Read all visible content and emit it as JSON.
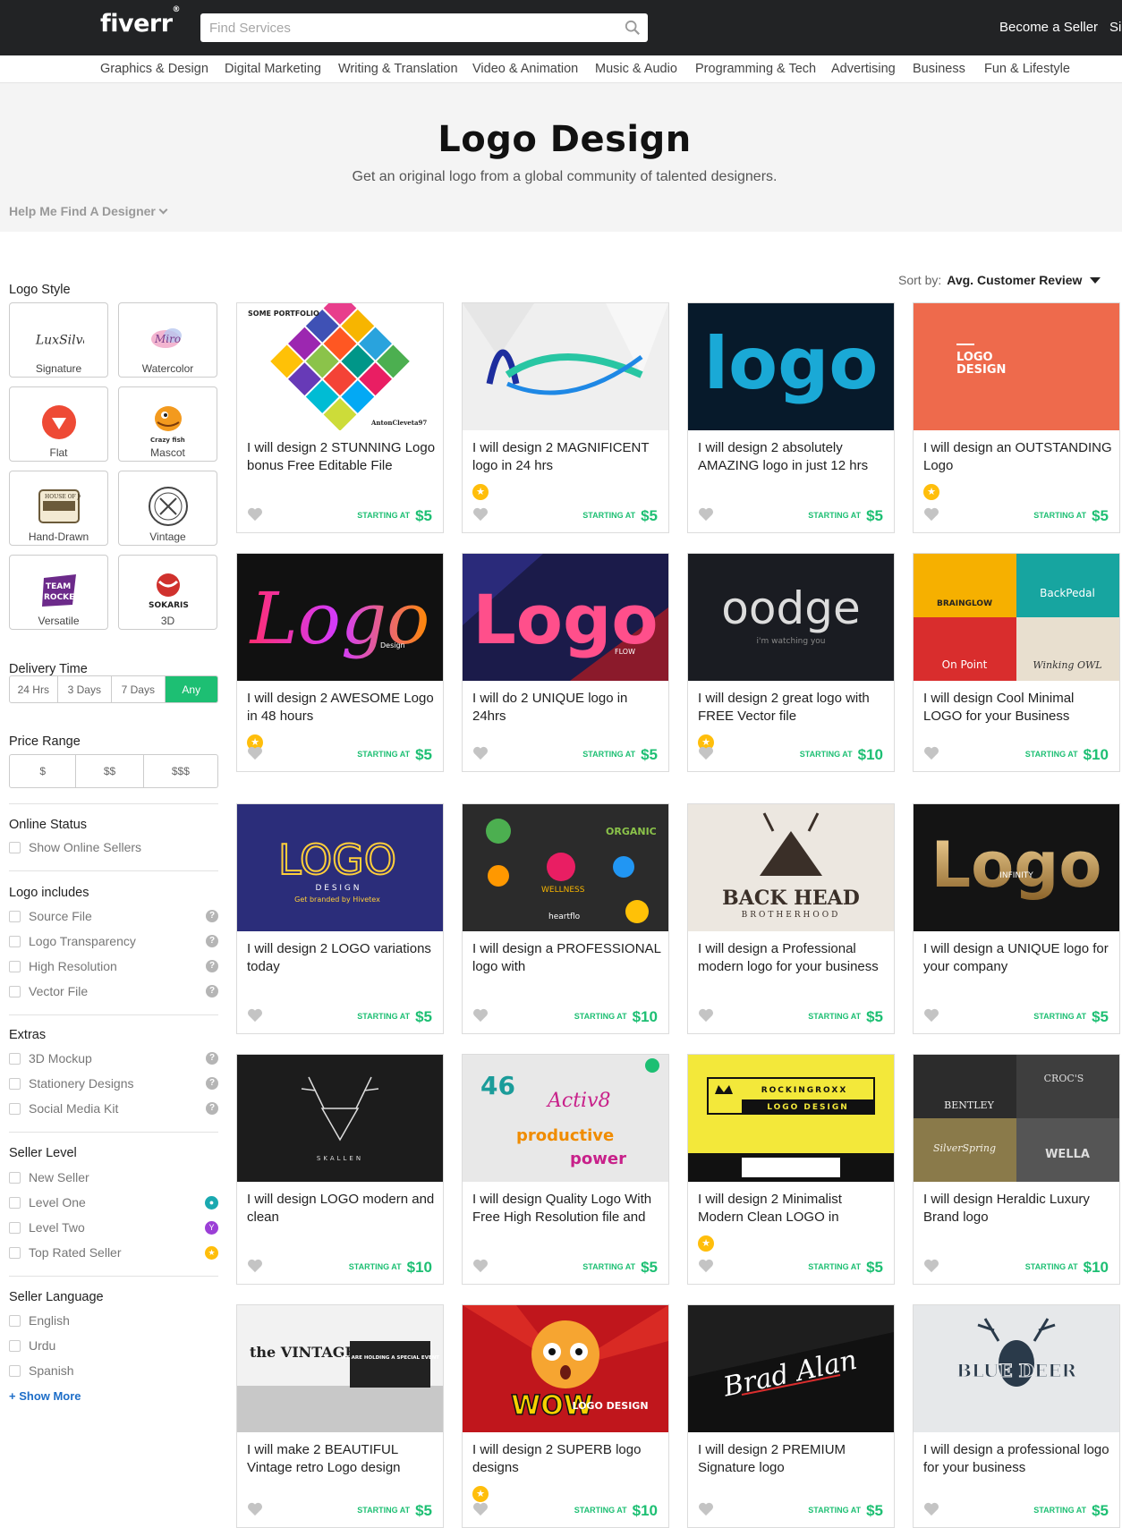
{
  "header": {
    "logo": "fiverr",
    "search_placeholder": "Find Services",
    "become_seller": "Become a Seller",
    "signin": "Sign In"
  },
  "nav": [
    "Graphics & Design",
    "Digital Marketing",
    "Writing & Translation",
    "Video & Animation",
    "Music & Audio",
    "Programming & Tech",
    "Advertising",
    "Business",
    "Fun & Lifestyle"
  ],
  "hero": {
    "title": "Logo Design",
    "subtitle": "Get an original logo from a global community of talented designers.",
    "help": "Help Me Find A Designer"
  },
  "sidebar": {
    "logo_style_title": "Logo Style",
    "styles": [
      "Signature",
      "Watercolor",
      "Flat",
      "Mascot",
      "Hand-Drawn",
      "Vintage",
      "Versatile",
      "3D"
    ],
    "delivery_title": "Delivery Time",
    "delivery_options": [
      "24 Hrs",
      "3 Days",
      "7 Days",
      "Any"
    ],
    "delivery_selected": "Any",
    "price_title": "Price Range",
    "price_options": [
      "$",
      "$$",
      "$$$"
    ],
    "online_title": "Online Status",
    "online_options": [
      "Show Online Sellers"
    ],
    "includes_title": "Logo includes",
    "includes_options": [
      "Source File",
      "Logo Transparency",
      "High Resolution",
      "Vector File"
    ],
    "extras_title": "Extras",
    "extras_options": [
      "3D Mockup",
      "Stationery Designs",
      "Social Media Kit"
    ],
    "level_title": "Seller Level",
    "level_options": [
      "New Seller",
      "Level One",
      "Level Two",
      "Top Rated Seller"
    ],
    "language_title": "Seller Language",
    "language_options": [
      "English",
      "Urdu",
      "Spanish"
    ],
    "show_more": "+ Show More"
  },
  "sort": {
    "label": "Sort by:",
    "value": "Avg. Customer Review"
  },
  "starting_at": "STARTING AT",
  "cards": [
    {
      "title": "I will design 2 STUNNING Logo bonus Free Editable File",
      "price": "$5",
      "badge": false
    },
    {
      "title": "I will design 2 MAGNIFICENT logo in 24 hrs",
      "price": "$5",
      "badge": true
    },
    {
      "title": "I will design 2 absolutely AMAZING logo in just 12 hrs",
      "price": "$5",
      "badge": false
    },
    {
      "title": "I will design an OUTSTANDING Logo",
      "price": "$5",
      "badge": true
    },
    {
      "title": "I will design 2 AWESOME Logo in 48 hours",
      "price": "$5",
      "badge": true
    },
    {
      "title": "I will do 2 UNIQUE logo in 24hrs",
      "price": "$5",
      "badge": false
    },
    {
      "title": "I will design 2 great logo with FREE Vector file",
      "price": "$10",
      "badge": true
    },
    {
      "title": "I will design Cool Minimal LOGO for your Business",
      "price": "$10",
      "badge": false
    },
    {
      "title": "I will design 2 LOGO variations today",
      "price": "$5",
      "badge": false
    },
    {
      "title": "I will design a PROFESSIONAL logo with",
      "price": "$10",
      "badge": false
    },
    {
      "title": "I will design a Professional modern logo for your business",
      "price": "$5",
      "badge": false
    },
    {
      "title": "I will design a UNIQUE logo for your company",
      "price": "$5",
      "badge": false
    },
    {
      "title": "I will design LOGO modern and clean",
      "price": "$10",
      "badge": false
    },
    {
      "title": "I will design Quality Logo With Free High Resolution file and",
      "price": "$5",
      "badge": false
    },
    {
      "title": "I will design 2 Minimalist Modern Clean LOGO in",
      "price": "$5",
      "badge": true
    },
    {
      "title": "I will design Heraldic Luxury Brand logo",
      "price": "$10",
      "badge": false
    },
    {
      "title": "I will make 2 BEAUTIFUL Vintage retro Logo design",
      "price": "$5",
      "badge": false
    },
    {
      "title": "I will design 2 SUPERB logo designs",
      "price": "$10",
      "badge": true
    },
    {
      "title": "I will design 2 PREMIUM Signature logo",
      "price": "$5",
      "badge": false
    },
    {
      "title": "I will design a professional logo for your business",
      "price": "$5",
      "badge": false
    }
  ],
  "thumb_text": {
    "t0a": "SOME PORTFOLIO",
    "t0b": "AntonCleveta97",
    "t2": "logo",
    "t3": "LOGO DESIGN",
    "t4": "Logo",
    "t4b": "Design",
    "t5": "Logo",
    "t5b": "FLOW",
    "t6": "oodge",
    "t6b": "i'm watching you",
    "t7a": "BRAINGLOW",
    "t7b": "BackPedal",
    "t7c": "On Point",
    "t7d": "Winking OWL",
    "t8": "LOGO",
    "t8b": "D E S I G N",
    "t8c": "Get branded by Hivetex",
    "t9a": "ORGANIC",
    "t9b": "WELLNESS",
    "t9c": "heartflo",
    "t10": "BACK HEAD",
    "t10b": "BROTHERHOOD",
    "t11": "Logo",
    "t11b": "INFINITY",
    "t12": "SKALLEN",
    "t13a": "Activ8",
    "t13b": "productive",
    "t13c": "power",
    "t14a": "ROCKINGROXX",
    "t14b": "LOGO DESIGN",
    "t15a": "BENTLEY",
    "t15b": "CROC'S",
    "t15c": "SilverSpring",
    "t15d": "WELLA",
    "t16a": "the VINTAGE LOGO",
    "t16b": "WE ARE HOLDING A SPECIAL EVENT",
    "t17": "WOW",
    "t17b": "LOGO DESIGN",
    "t18": "Brad Alan",
    "t19": "BLUE DEER"
  }
}
